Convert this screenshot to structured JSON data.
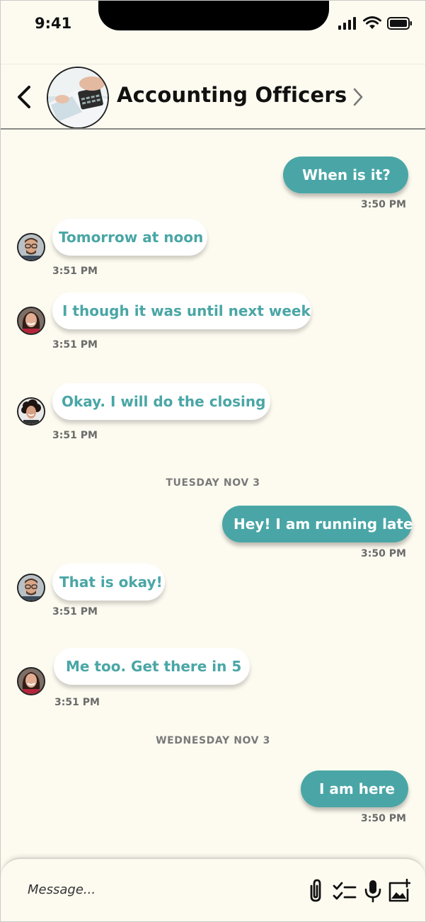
{
  "status": {
    "time": "9:41"
  },
  "header": {
    "title": "Accounting Officers",
    "back_icon": "chevron-left-icon",
    "info_icon": "chevron-right-icon"
  },
  "messages": [
    {
      "direction": "out",
      "text": "When is it?",
      "time": "3:50 PM"
    },
    {
      "direction": "in",
      "text": "Tomorrow at noon",
      "time": "3:51 PM"
    },
    {
      "direction": "in",
      "text": "I though it was until next week",
      "time": "3:51 PM"
    },
    {
      "direction": "in",
      "text": "Okay. I will do the closing",
      "time": "3:51 PM"
    },
    {
      "direction": "out",
      "text": "Hey! I am running late",
      "time": "3:50 PM"
    },
    {
      "direction": "in",
      "text": "That is okay!",
      "time": "3:51 PM"
    },
    {
      "direction": "in",
      "text": "Me too. Get there in 5",
      "time": "3:51 PM"
    },
    {
      "direction": "out",
      "text": "I am here",
      "time": "3:50 PM"
    }
  ],
  "dates": [
    "TUESDAY NOV 3",
    "WEDNESDAY NOV 3"
  ],
  "composer": {
    "placeholder": "Message...",
    "tools": [
      "paperclip-icon",
      "checklist-icon",
      "microphone-icon",
      "add-image-icon"
    ]
  },
  "colors": {
    "accent": "#4aa6a6",
    "background": "#fdfbf0",
    "bubble_in": "#ffffff"
  }
}
